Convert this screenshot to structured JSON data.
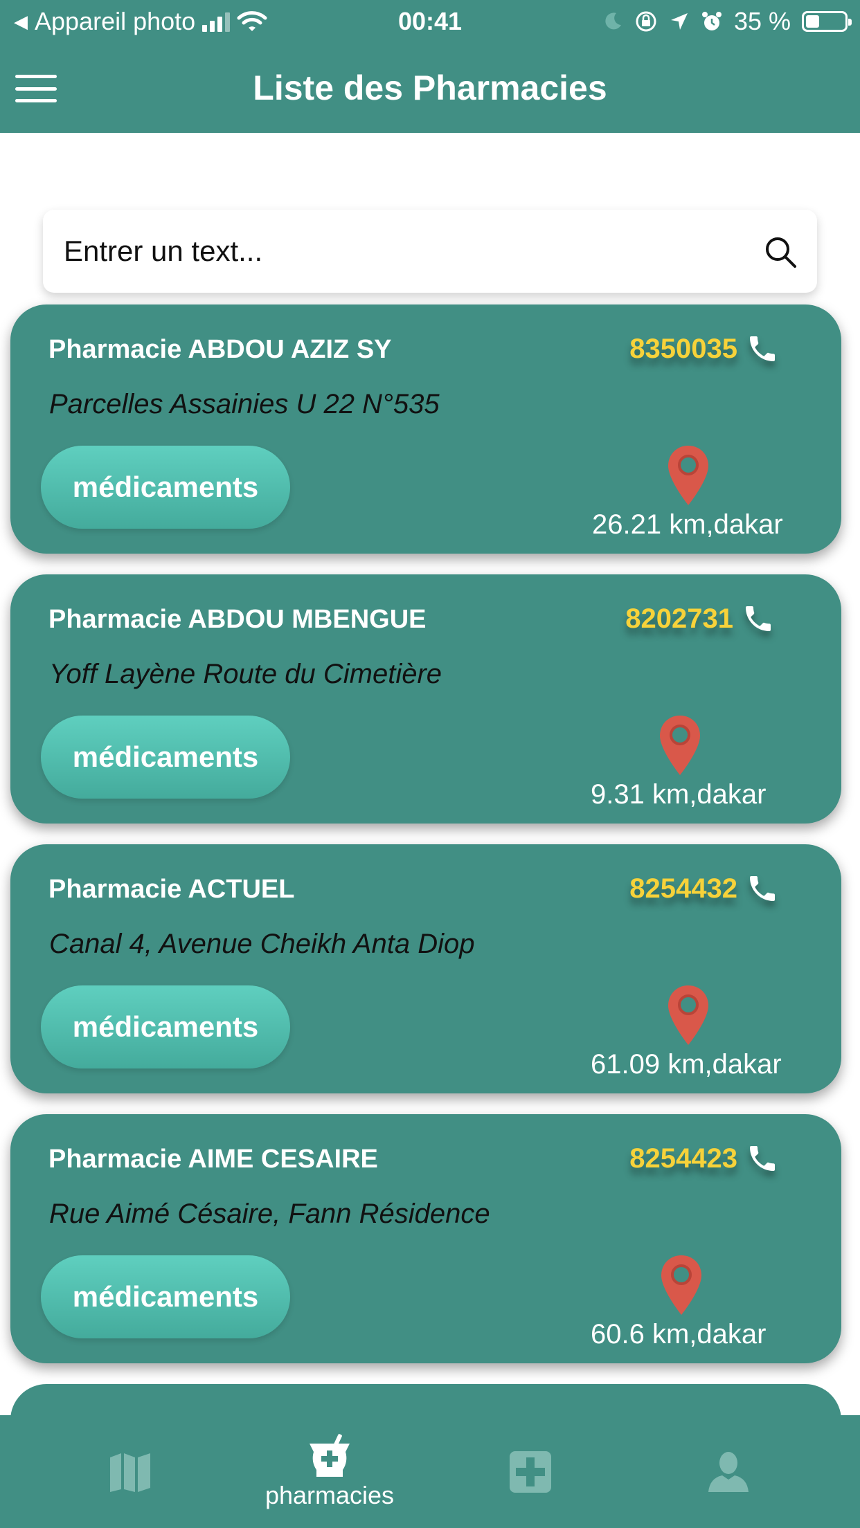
{
  "status_bar": {
    "back_app": "Appareil photo",
    "time": "00:41",
    "battery": "35 %",
    "battery_level": 0.35
  },
  "header": {
    "title": "Liste des Pharmacies",
    "menu_icon": "hamburger-menu-icon"
  },
  "search": {
    "placeholder": "Entrer un text...",
    "value": "",
    "icon": "search-icon"
  },
  "colors": {
    "primary": "#418f84",
    "button": "#54bfae",
    "phone_number": "#f7d23a",
    "pin": "#d9584a"
  },
  "pharmacies": [
    {
      "name": "Pharmacie ABDOU AZIZ SY",
      "phone": "8350035",
      "address": "Parcelles Assainies U 22 N°535",
      "button_label": "médicaments",
      "distance": "26.21 km,dakar"
    },
    {
      "name": "Pharmacie ABDOU MBENGUE",
      "phone": "8202731",
      "address": "Yoff Layène Route du Cimetière",
      "button_label": "médicaments",
      "distance": "9.31 km,dakar"
    },
    {
      "name": "Pharmacie ACTUEL",
      "phone": "8254432",
      "address": "Canal 4, Avenue Cheikh Anta Diop",
      "button_label": "médicaments",
      "distance": "61.09 km,dakar"
    },
    {
      "name": "Pharmacie AIME CESAIRE",
      "phone": "8254423",
      "address": "Rue Aimé Césaire, Fann Résidence",
      "button_label": "médicaments",
      "distance": "60.6 km,dakar"
    }
  ],
  "tabbar": {
    "tabs": [
      {
        "icon": "map-icon",
        "label": ""
      },
      {
        "icon": "pharmacy-mortar-icon",
        "label": "pharmacies",
        "active": true
      },
      {
        "icon": "medical-cross-icon",
        "label": ""
      },
      {
        "icon": "user-icon",
        "label": ""
      }
    ]
  }
}
